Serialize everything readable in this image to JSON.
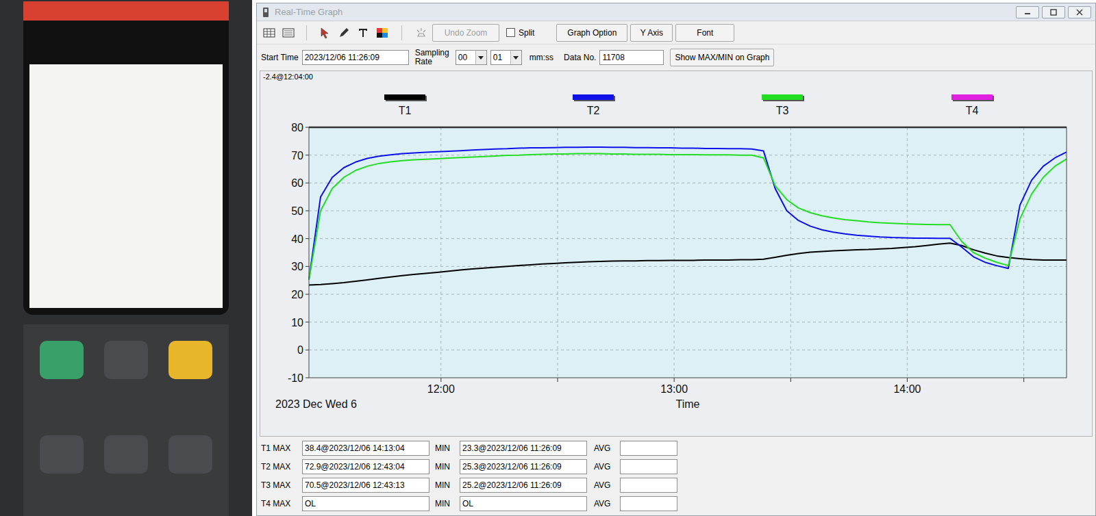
{
  "window": {
    "title": "Real-Time Graph"
  },
  "toolbar": {
    "buttons": [
      {
        "label": "Undo Zoom",
        "disabled": true
      },
      {
        "label": "Graph Option",
        "disabled": false
      },
      {
        "label": "Y Axis",
        "disabled": false
      },
      {
        "label": "Font",
        "disabled": false
      }
    ],
    "split": {
      "label": "Split",
      "checked": false
    }
  },
  "settings": {
    "start_time_label": "Start Time",
    "start_time": "2023/12/06 11:26:09",
    "sampling_label": [
      "Sampling",
      "Rate"
    ],
    "sampling_minutes": "00",
    "sampling_seconds": "01",
    "sampling_unit": "mm:ss",
    "data_no_label": "Data No.",
    "data_no": "11708",
    "show_maxmin_button": "Show MAX/MIN on Graph"
  },
  "chart": {
    "cursor_readout": "-2.4@12:04:00",
    "y_ticks": [
      "80",
      "70",
      "60",
      "50",
      "40",
      "30",
      "20",
      "10",
      "0",
      "-10"
    ],
    "x_ticks": [
      "12:00",
      "13:00",
      "14:00"
    ],
    "x_title": "Time",
    "date": "2023 Dec Wed 6",
    "series": [
      {
        "name": "T1",
        "color": "#000000",
        "values": [
          23.3,
          23.5,
          23.8,
          24.2,
          24.7,
          25.2,
          25.7,
          26.2,
          26.7,
          27.1,
          27.5,
          27.9,
          28.3,
          28.7,
          29.1,
          29.4,
          29.7,
          30,
          30.3,
          30.6,
          30.9,
          31.1,
          31.3,
          31.5,
          31.7,
          31.8,
          31.9,
          32,
          32,
          32.1,
          32.1,
          32.2,
          32.2,
          32.2,
          32.3,
          32.3,
          32.3,
          32.4,
          32.4,
          32.6,
          33.3,
          34,
          34.6,
          35.1,
          35.4,
          35.6,
          35.8,
          36,
          36.1,
          36.3,
          36.5,
          36.8,
          37.1,
          37.5,
          38,
          38.4,
          37.5,
          36,
          34.8,
          33.8,
          33.2,
          32.8,
          32.5,
          32.3,
          32.3,
          32.3
        ]
      },
      {
        "name": "T2",
        "color": "#1010e8",
        "values": [
          25.3,
          55,
          62,
          65.5,
          67.5,
          68.8,
          69.6,
          70.1,
          70.5,
          70.8,
          71,
          71.2,
          71.4,
          71.6,
          71.8,
          72,
          72.2,
          72.3,
          72.5,
          72.6,
          72.6,
          72.7,
          72.8,
          72.8,
          72.9,
          72.9,
          72.8,
          72.8,
          72.7,
          72.7,
          72.6,
          72.6,
          72.5,
          72.5,
          72.4,
          72.4,
          72.3,
          72.3,
          72.2,
          71.5,
          58,
          50,
          46.5,
          44.5,
          43.2,
          42.3,
          41.7,
          41.2,
          40.9,
          40.6,
          40.4,
          40.3,
          40.2,
          40.2,
          40.1,
          40.1,
          37,
          33.5,
          31.5,
          30.3,
          29.3,
          52,
          61,
          66,
          69,
          71.1
        ]
      },
      {
        "name": "T3",
        "color": "#22dd22",
        "values": [
          25.2,
          50,
          58,
          62,
          64.5,
          66,
          67,
          67.6,
          68,
          68.3,
          68.5,
          68.7,
          68.9,
          69.1,
          69.3,
          69.5,
          69.7,
          69.9,
          70,
          70.2,
          70.3,
          70.4,
          70.4,
          70.5,
          70.5,
          70.5,
          70.4,
          70.4,
          70.3,
          70.3,
          70.3,
          70.2,
          70.2,
          70.2,
          70.1,
          70.1,
          70.1,
          70,
          70,
          69,
          59,
          54,
          51,
          49.3,
          48.2,
          47.4,
          46.8,
          46.4,
          46,
          45.7,
          45.5,
          45.3,
          45.2,
          45.1,
          45,
          45,
          39,
          35,
          33,
          31.5,
          30.3,
          47,
          56,
          62,
          66,
          68.6
        ]
      },
      {
        "name": "T4",
        "color": "#e020e0",
        "values": []
      }
    ]
  },
  "stats": [
    {
      "label": "T1 MAX",
      "max": "38.4@2023/12/06 14:13:04",
      "min_label": "MIN",
      "min": "23.3@2023/12/06 11:26:09",
      "avg_label": "AVG",
      "avg": ""
    },
    {
      "label": "T2 MAX",
      "max": "72.9@2023/12/06 12:43:04",
      "min_label": "MIN",
      "min": "25.3@2023/12/06 11:26:09",
      "avg_label": "AVG",
      "avg": ""
    },
    {
      "label": "T3 MAX",
      "max": "70.5@2023/12/06 12:43:13",
      "min_label": "MIN",
      "min": "25.2@2023/12/06 11:26:09",
      "avg_label": "AVG",
      "avg": ""
    },
    {
      "label": "T4 MAX",
      "max": "OL",
      "min_label": "MIN",
      "min": "OL",
      "avg_label": "AVG",
      "avg": ""
    }
  ]
}
